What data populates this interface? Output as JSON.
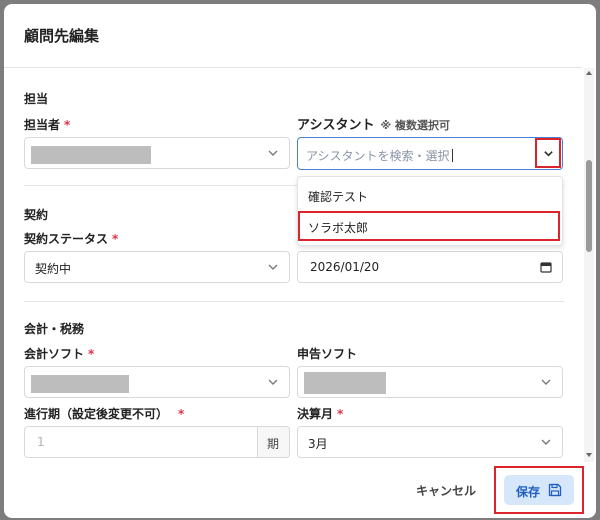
{
  "modal": {
    "title": "顧問先編集"
  },
  "sections": {
    "tantou": {
      "title": "担当",
      "tantousha_label": "担当者",
      "required_mark": "*",
      "assistant_label": "アシスタント",
      "assistant_hint": "※ 複数選択可",
      "assistant_placeholder": "アシスタントを検索・選択",
      "assistant_options": [
        "確認テスト",
        "ソラボ太郎"
      ]
    },
    "keiyaku": {
      "title": "契約",
      "status_label": "契約ステータス",
      "status_value": "契約中",
      "date_value": "2026/01/20"
    },
    "kaikei": {
      "title": "会計・税務",
      "soft_label": "会計ソフト",
      "shinkoku_label": "申告ソフト",
      "period_label": "進行期（設定後変更不可）",
      "period_value": "1",
      "period_suffix": "期",
      "kessan_label": "決算月",
      "kessan_value": "3月"
    }
  },
  "footer": {
    "cancel_label": "キャンセル",
    "save_label": "保存"
  },
  "icons": {
    "chevron": "chevron-down-icon",
    "calendar": "calendar-icon",
    "save": "save-icon"
  },
  "colors": {
    "accent": "#1f5fbf",
    "save_bg": "#d6e6fb",
    "required": "#e0324a",
    "annotation": "#d9252b"
  }
}
